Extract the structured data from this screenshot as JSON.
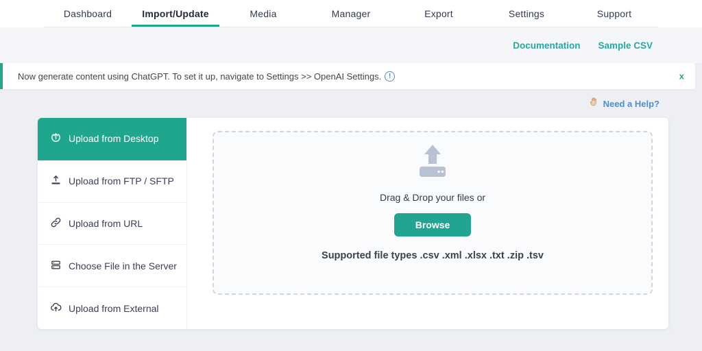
{
  "nav": {
    "tabs": [
      "Dashboard",
      "Import/Update",
      "Media",
      "Manager",
      "Export",
      "Settings",
      "Support"
    ],
    "active_tab": "Import/Update"
  },
  "links": {
    "documentation": "Documentation",
    "sample_csv": "Sample CSV"
  },
  "notice": {
    "text": "Now generate content using ChatGPT. To set it up, navigate to Settings >> OpenAI Settings.",
    "info_icon": "!",
    "close_label": "x"
  },
  "help": {
    "label": "Need a Help?",
    "icon": "raised-hand-icon"
  },
  "sidebar": {
    "items": [
      {
        "label": "Upload from Desktop",
        "icon": "upload-circle-icon",
        "active": true
      },
      {
        "label": "Upload from FTP / SFTP",
        "icon": "upload-tray-icon",
        "active": false
      },
      {
        "label": "Upload from URL",
        "icon": "link-icon",
        "active": false
      },
      {
        "label": "Choose File in the Server",
        "icon": "server-icon",
        "active": false
      },
      {
        "label": "Upload from External",
        "icon": "cloud-upload-icon",
        "active": false
      }
    ]
  },
  "dropzone": {
    "icon": "upload-drive-icon",
    "drag_text": "Drag & Drop your files or",
    "browse_label": "Browse",
    "supported_text": "Supported file types .csv .xml .xlsx .txt .zip .tsv"
  },
  "colors": {
    "accent_teal": "#1fa78e",
    "link_teal": "#29a8a0",
    "link_blue": "#4a8fd4",
    "info_blue": "#4f86d8",
    "dropzone_icon_gray": "#b9c2d2"
  }
}
